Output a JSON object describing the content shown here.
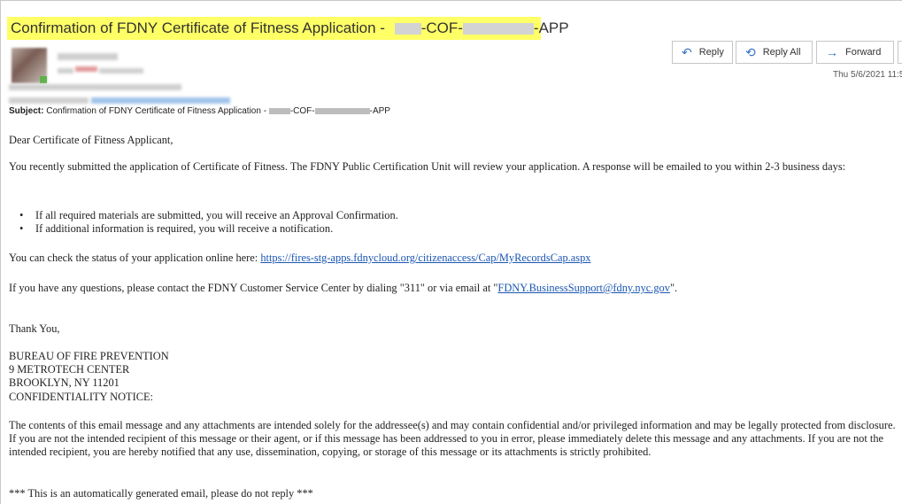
{
  "header": {
    "subject_prefix": "Confirmation of FDNY Certificate of Fitness Application -",
    "subject_mid": "-COF-",
    "subject_suffix": "-APP"
  },
  "actions": {
    "reply": "Reply",
    "reply_all": "Reply All",
    "forward": "Forward"
  },
  "date": "Thu 5/6/2021 11:5",
  "subject_meta": {
    "label": "Subject:",
    "prefix": "Confirmation of FDNY Certificate of Fitness Application -",
    "mid": "-COF-",
    "suffix": "-APP"
  },
  "body": {
    "greeting": "Dear Certificate of Fitness Applicant,",
    "intro": "You recently submitted the application of Certificate of Fitness. The FDNY Public Certification Unit will review your application. A response will be emailed to you within 2-3 business days:",
    "bullets": [
      "If all required materials are submitted, you will receive an Approval Confirmation.",
      "If additional information is required, you will receive a notification."
    ],
    "status_text": "You can check the status of your application online here: ",
    "status_link": "https://fires-stg-apps.fdnycloud.org/citizenaccess/Cap/MyRecordsCap.aspx",
    "contact_text": "If you have any questions, please contact the FDNY Customer Service Center by dialing \"311\" or via email at \"",
    "contact_link": "FDNY.BusinessSupport@fdny.nyc.gov",
    "contact_end": "\".",
    "thanks": "Thank You,",
    "address": [
      "BUREAU OF FIRE PREVENTION",
      "9 METROTECH CENTER",
      "BROOKLYN, NY 11201"
    ],
    "notice_heading": "CONFIDENTIALITY NOTICE:",
    "confidentiality": "The contents of this email message and any attachments are intended solely for the addressee(s) and may contain confidential and/or privileged information and may be legally protected from disclosure. If you are not the intended recipient of this message or their agent, or if this message has been addressed to you in error, please immediately delete this message and any attachments. If you are not the intended recipient, you are hereby notified that any use, dissemination, copying, or storage of this message or its attachments is strictly prohibited.",
    "auto_note": "*** This is an automatically generated email, please do not reply ***"
  },
  "colors": {
    "highlight": "#ffff66",
    "link": "#1a56b3",
    "icon": "#3471c4"
  },
  "icons": {
    "reply": "reply-arrow-icon",
    "reply_all": "reply-all-arrow-icon",
    "forward": "forward-arrow-icon"
  }
}
